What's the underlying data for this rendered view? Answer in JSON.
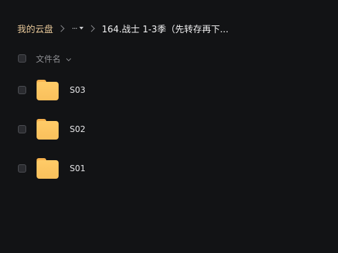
{
  "breadcrumb": {
    "root": "我的云盘",
    "more": "···",
    "current": "164.战士 1-3季（先转存再下..."
  },
  "list_header": {
    "column_label": "文件名"
  },
  "files": [
    {
      "name": "S03",
      "type": "folder"
    },
    {
      "name": "S02",
      "type": "folder"
    },
    {
      "name": "S01",
      "type": "folder"
    }
  ],
  "colors": {
    "background": "#121315",
    "breadcrumb_root": "#e9c99a",
    "folder": "#ffcb68"
  },
  "icons": [
    "chevron-right-icon",
    "caret-down-icon",
    "chevron-down-icon",
    "folder-icon"
  ]
}
